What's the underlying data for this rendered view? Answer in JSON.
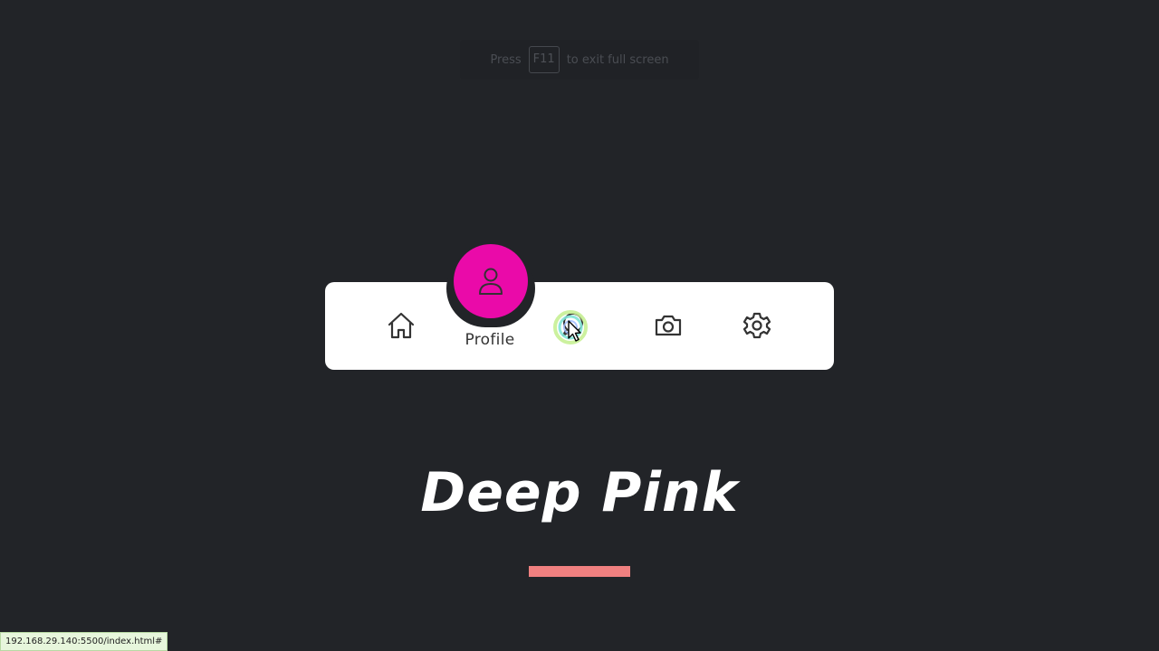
{
  "fullscreen_hint": {
    "prefix": "Press",
    "key": "F11",
    "suffix": "to exit full screen"
  },
  "nav": {
    "items": [
      {
        "icon": "home-icon"
      },
      {
        "icon": "profile-icon",
        "label": "Profile",
        "active": true
      },
      {
        "icon": "chat-icon"
      },
      {
        "icon": "camera-icon"
      },
      {
        "icon": "settings-icon"
      }
    ]
  },
  "heading": {
    "text": "Deep Pink"
  },
  "status_bar": {
    "url": "192.168.29.140:5500/index.html#"
  },
  "colors": {
    "background": "#222428",
    "indicator": "#ea0aa9",
    "underline": "#f08080",
    "nav_bg": "#ffffff"
  }
}
